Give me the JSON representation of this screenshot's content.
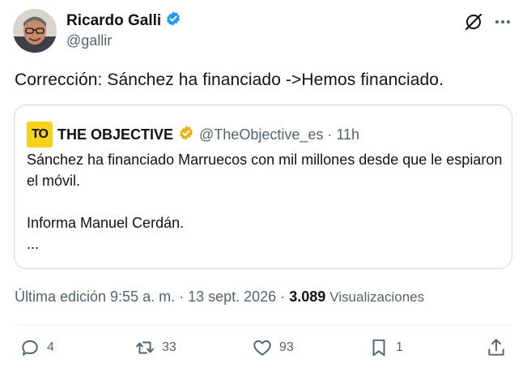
{
  "author": {
    "name": "Ricardo Galli",
    "handle": "@gallir",
    "verified_color": "#1d9bf0"
  },
  "tweet_text": "Corrección: Sánchez ha financiado ->Hemos financiado.",
  "quote": {
    "logo_text": "TO",
    "logo_color": "#f4d31a",
    "name": "THE OBJECTIVE",
    "verified_color": "#e2b719",
    "handle_time": "@TheObjective_es · 11h",
    "line1": "Sánchez ha financiado Marruecos con mil millones desde que le espiaron el móvil.",
    "line2": "Informa Manuel Cerdán.",
    "line3": "..."
  },
  "meta": {
    "edited_time": "Última edición 9:55 a. m. · 13 sept. 2026 ·",
    "views_count": "3.089",
    "views_label": "Visualizaciones"
  },
  "actions": {
    "replies": "4",
    "reposts": "33",
    "likes": "93",
    "bookmarks": "1"
  },
  "icons": [
    "grok-icon",
    "more-icon",
    "reply-icon",
    "retweet-icon",
    "heart-icon",
    "bookmark-icon",
    "share-icon",
    "verified-badge-icon"
  ]
}
